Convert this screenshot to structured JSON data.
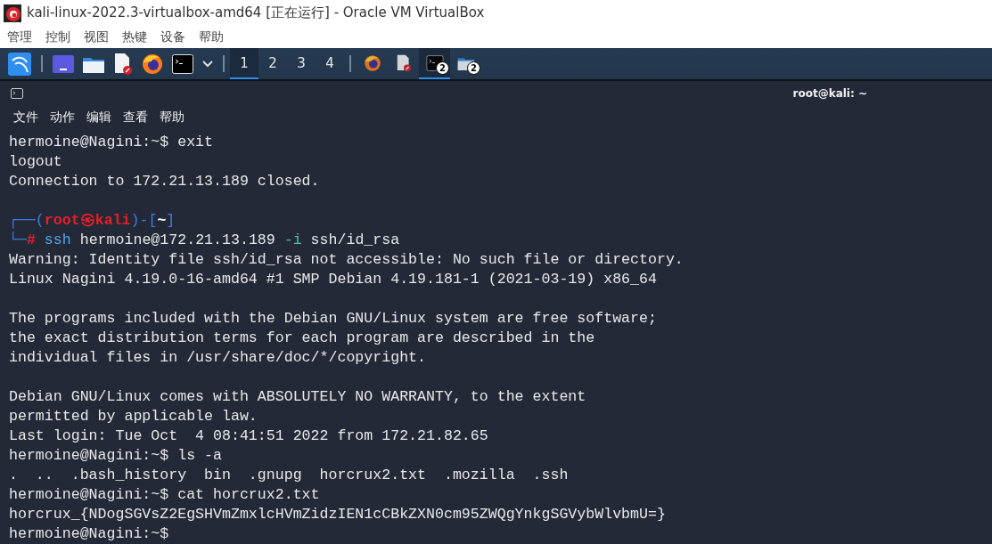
{
  "window": {
    "title": "kali-linux-2022.3-virtualbox-amd64 [正在运行] - Oracle VM VirtualBox"
  },
  "menu": [
    "管理",
    "控制",
    "视图",
    "热键",
    "设备",
    "帮助"
  ],
  "taskbar": {
    "launchers": [
      {
        "kind": "kali"
      },
      {
        "kind": "desktop"
      },
      {
        "kind": "folder"
      },
      {
        "kind": "editor"
      },
      {
        "kind": "firefox"
      },
      {
        "kind": "terminal"
      },
      {
        "kind": "caret"
      }
    ],
    "workspaces": [
      {
        "label": "1",
        "selected": true
      },
      {
        "label": "2",
        "selected": false
      },
      {
        "label": "3",
        "selected": false
      },
      {
        "label": "4",
        "selected": false
      }
    ],
    "windows": [
      {
        "kind": "firefox",
        "selected": false
      },
      {
        "kind": "editor",
        "selected": false
      },
      {
        "kind": "terminal",
        "selected": true,
        "badge": "2"
      },
      {
        "kind": "folder",
        "selected": false,
        "badge": "2"
      }
    ]
  },
  "terminal": {
    "title": "root@kali: ~",
    "menu": [
      "文件",
      "动作",
      "编辑",
      "查看",
      "帮助"
    ],
    "blocks": [
      {
        "lines": [
          {
            "segments": [
              {
                "kind": "plain",
                "text": "hermoine@Nagini:~$ exit"
              }
            ]
          },
          {
            "segments": [
              {
                "kind": "plain",
                "text": "logout"
              }
            ]
          },
          {
            "segments": [
              {
                "kind": "plain",
                "text": "Connection to 172.21.13.189 closed."
              }
            ]
          }
        ]
      },
      {
        "lines": [
          {
            "segments": [
              {
                "kind": "frame",
                "text": "┌──("
              },
              {
                "kind": "user",
                "text": "root㉿kali"
              },
              {
                "kind": "frame",
                "text": ")-["
              },
              {
                "kind": "dir",
                "text": "~"
              },
              {
                "kind": "frame",
                "text": "]"
              }
            ]
          },
          {
            "segments": [
              {
                "kind": "frame",
                "text": "└─"
              },
              {
                "kind": "user",
                "text": "#"
              },
              {
                "kind": "command",
                "text": "ssh"
              },
              {
                "kind": "plain",
                "text": " hermoine@172.21.13.189 "
              },
              {
                "kind": "option",
                "text": "-i"
              },
              {
                "kind": "plain",
                "text": " ssh/id_rsa"
              }
            ]
          },
          {
            "segments": [
              {
                "kind": "plain",
                "text": "Warning: Identity file ssh/id_rsa not accessible: No such file or directory."
              }
            ]
          },
          {
            "segments": [
              {
                "kind": "plain",
                "text": "Linux Nagini 4.19.0-16-amd64 #1 SMP Debian 4.19.181-1 (2021-03-19) x86_64"
              }
            ]
          }
        ]
      },
      {
        "lines": [
          {
            "segments": [
              {
                "kind": "plain",
                "text": "The programs included with the Debian GNU/Linux system are free software;"
              }
            ]
          },
          {
            "segments": [
              {
                "kind": "plain",
                "text": "the exact distribution terms for each program are described in the"
              }
            ]
          },
          {
            "segments": [
              {
                "kind": "plain",
                "text": "individual files in /usr/share/doc/*/copyright."
              }
            ]
          }
        ]
      },
      {
        "lines": [
          {
            "segments": [
              {
                "kind": "plain",
                "text": "Debian GNU/Linux comes with ABSOLUTELY NO WARRANTY, to the extent"
              }
            ]
          },
          {
            "segments": [
              {
                "kind": "plain",
                "text": "permitted by applicable law."
              }
            ]
          },
          {
            "segments": [
              {
                "kind": "plain",
                "text": "Last login: Tue Oct  4 08:41:51 2022 from 172.21.82.65"
              }
            ]
          },
          {
            "segments": [
              {
                "kind": "plain",
                "text": "hermoine@Nagini:~$ ls -a"
              }
            ]
          },
          {
            "segments": [
              {
                "kind": "plain",
                "text": ".  ..  .bash_history  bin  .gnupg  horcrux2.txt  .mozilla  .ssh"
              }
            ]
          },
          {
            "segments": [
              {
                "kind": "plain",
                "text": "hermoine@Nagini:~$ cat horcrux2.txt"
              }
            ]
          },
          {
            "segments": [
              {
                "kind": "plain",
                "text": "horcrux_{NDogSGVsZ2EgSHVmZmxlcHVmZidzIEN1cCBkZXN0cm95ZWQgYnkgSGVybWlvbmU=}"
              }
            ]
          },
          {
            "segments": [
              {
                "kind": "plain",
                "text": "hermoine@Nagini:~$"
              }
            ]
          }
        ]
      }
    ]
  }
}
